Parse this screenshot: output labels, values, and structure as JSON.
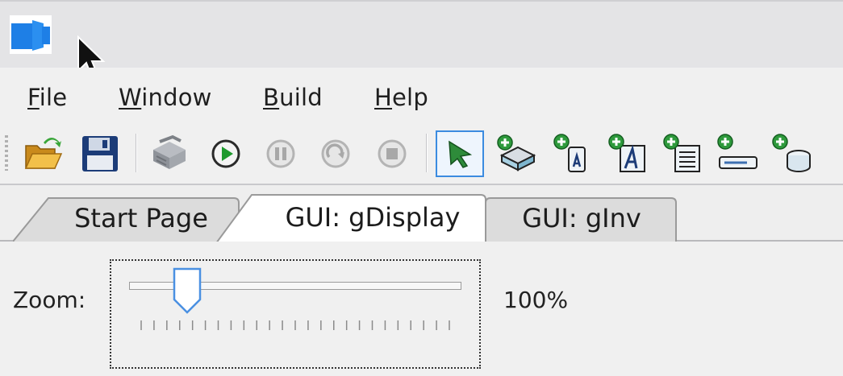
{
  "titlebar": {
    "logo_icon": "app-logo-icon",
    "accent": "#1e7fe6"
  },
  "menu": {
    "items": [
      {
        "label": "File",
        "mnemonic": "F",
        "rest": "ile"
      },
      {
        "label": "Window",
        "mnemonic": "W",
        "rest": "indow"
      },
      {
        "label": "Build",
        "mnemonic": "B",
        "rest": "uild"
      },
      {
        "label": "Help",
        "mnemonic": "H",
        "rest": "elp"
      }
    ]
  },
  "toolbar": {
    "buttons": [
      {
        "icon": "open-folder-icon"
      },
      {
        "icon": "save-icon"
      },
      {
        "icon": "compile-icon"
      },
      {
        "icon": "run-icon"
      },
      {
        "icon": "pause-icon"
      },
      {
        "icon": "step-icon"
      },
      {
        "icon": "stop-icon"
      },
      {
        "icon": "select-pointer-icon",
        "active": true
      },
      {
        "icon": "add-button-icon"
      },
      {
        "icon": "add-label-icon"
      },
      {
        "icon": "add-text-icon"
      },
      {
        "icon": "add-list-icon"
      },
      {
        "icon": "add-textfield-icon"
      },
      {
        "icon": "add-container-icon"
      }
    ]
  },
  "tabs": [
    {
      "label": "Start Page",
      "active": false
    },
    {
      "label": "GUI: gDisplay",
      "active": true
    },
    {
      "label": "GUI: gInv",
      "active": false
    }
  ],
  "zoom": {
    "label": "Zoom:",
    "value_text": "100%",
    "slider_fraction": 0.125
  }
}
